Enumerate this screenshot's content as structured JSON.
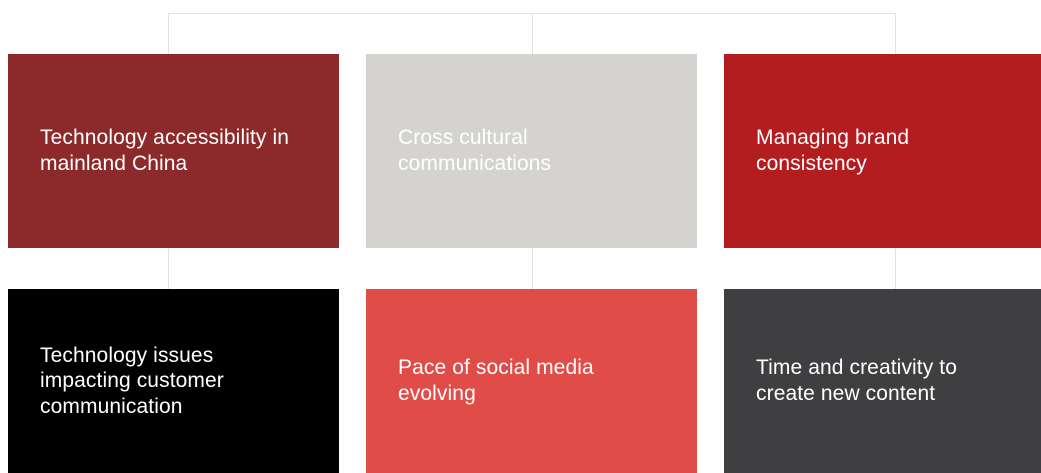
{
  "diagram": {
    "boxes": [
      {
        "label": "Technology accessibility in mainland China",
        "color": "#8c2a2b"
      },
      {
        "label": "Cross cultural communications",
        "color": "#d4d3cf"
      },
      {
        "label": "Managing brand consistency",
        "color": "#b41d20"
      },
      {
        "label": "Technology issues impacting customer communication",
        "color": "#000000"
      },
      {
        "label": "Pace of social media evolving",
        "color": "#e04c48"
      },
      {
        "label": "Time and creativity to create new content",
        "color": "#3f3f41"
      }
    ],
    "connector_color": "#e2e2e2"
  }
}
